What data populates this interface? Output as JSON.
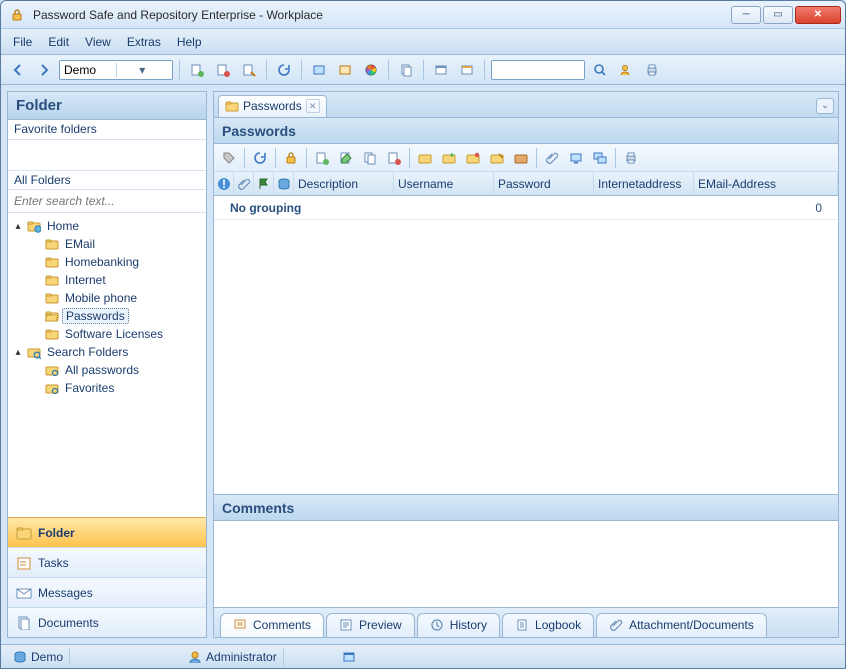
{
  "window": {
    "title": "Password Safe and Repository Enterprise - Workplace"
  },
  "menu": {
    "file": "File",
    "edit": "Edit",
    "view": "View",
    "extras": "Extras",
    "help": "Help"
  },
  "toolbar": {
    "combo_value": "Demo"
  },
  "left": {
    "header": "Folder",
    "favorite": "Favorite folders",
    "allfolders": "All Folders",
    "search_placeholder": "Enter search text...",
    "tree": {
      "home": "Home",
      "email": "EMail",
      "homebanking": "Homebanking",
      "internet": "Internet",
      "mobile": "Mobile phone",
      "passwords": "Passwords",
      "licenses": "Software Licenses",
      "searchfolders": "Search Folders",
      "allpasswords": "All passwords",
      "favorites": "Favorites"
    },
    "nav": {
      "folder": "Folder",
      "tasks": "Tasks",
      "messages": "Messages",
      "documents": "Documents"
    }
  },
  "tabs": {
    "passwords": "Passwords"
  },
  "pane": {
    "header": "Passwords",
    "cols": {
      "description": "Description",
      "username": "Username",
      "password": "Password",
      "internet": "Internetaddress",
      "email": "EMail-Address"
    },
    "group": {
      "label": "No grouping",
      "count": "0"
    }
  },
  "comments": {
    "header": "Comments"
  },
  "bottomtabs": {
    "comments": "Comments",
    "preview": "Preview",
    "history": "History",
    "logbook": "Logbook",
    "attach": "Attachment/Documents"
  },
  "status": {
    "db": "Demo",
    "user": "Administrator"
  }
}
